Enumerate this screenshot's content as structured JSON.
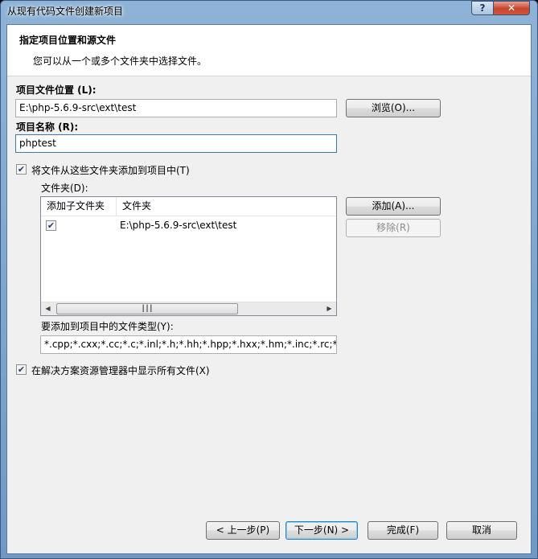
{
  "window": {
    "title": "从现有代码文件创建新项目",
    "help_label": "?",
    "close_label": "✕"
  },
  "header": {
    "title": "指定项目位置和源文件",
    "subtitle": "您可以从一个或多个文件夹中选择文件。"
  },
  "project_location": {
    "label": "项目文件位置 (L):",
    "value": "E:\\php-5.6.9-src\\ext\\test",
    "browse_label": "浏览(O)..."
  },
  "project_name": {
    "label": "项目名称 (R):",
    "value": "phptest"
  },
  "add_files": {
    "checkbox_label": "将文件从这些文件夹添加到项目中(T)",
    "checked": true
  },
  "folders": {
    "label": "文件夹(D):",
    "columns": [
      "添加子文件夹",
      "文件夹"
    ],
    "rows": [
      {
        "include_subfolders": true,
        "path": "E:\\php-5.6.9-src\\ext\\test"
      }
    ],
    "add_label": "添加(A)...",
    "remove_label": "移除(R)"
  },
  "file_types": {
    "label": "要添加到项目中的文件类型(Y):",
    "value": "*.cpp;*.cxx;*.cc;*.c;*.inl;*.h;*.hh;*.hpp;*.hxx;*.hm;*.inc;*.rc;*.resx;*.id"
  },
  "show_all_files": {
    "checkbox_label": "在解决方案资源管理器中显示所有文件(X)",
    "checked": true
  },
  "footer": {
    "back_label": "< 上一步(P)",
    "next_label": "下一步(N) >",
    "finish_label": "完成(F)",
    "cancel_label": "取消"
  }
}
